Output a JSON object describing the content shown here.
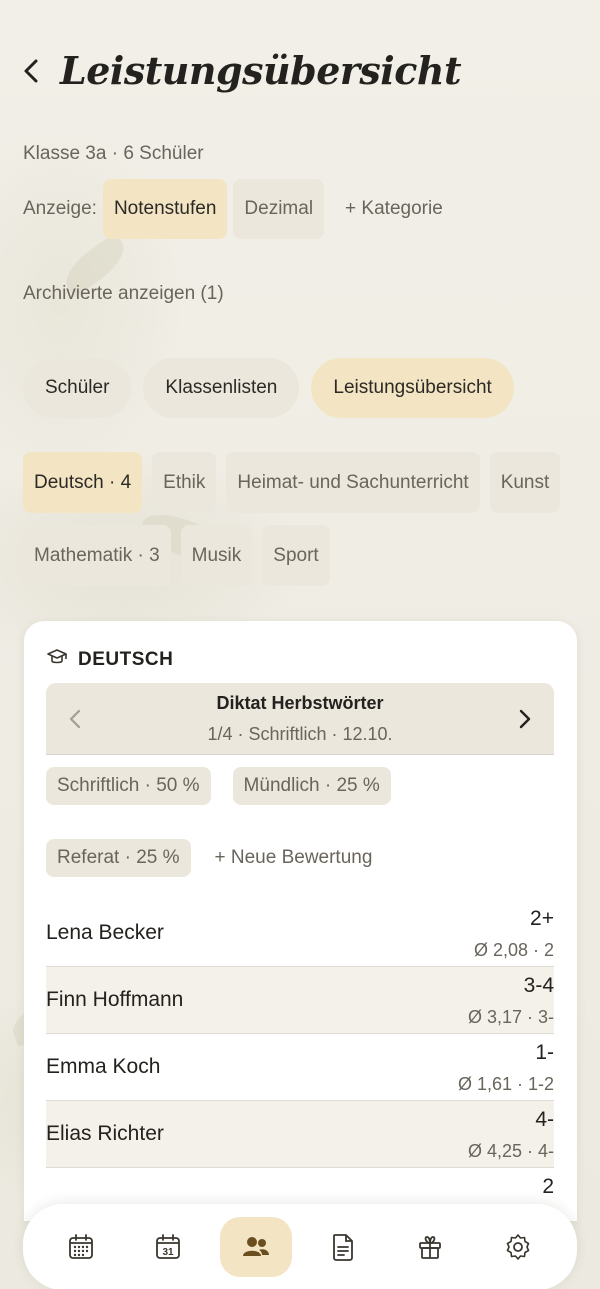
{
  "header": {
    "title": "Leistungsübersicht"
  },
  "meta": {
    "class_info": "Klasse 3a · 6 Schüler"
  },
  "view": {
    "label": "Anzeige:",
    "options": [
      "Notenstufen",
      "Dezimal"
    ],
    "selected": "Notenstufen",
    "add_category": "+ Kategorie"
  },
  "archived": "Archivierte anzeigen (1)",
  "tabs": [
    {
      "label": "Schüler"
    },
    {
      "label": "Klassenlisten"
    },
    {
      "label": "Leistungsübersicht",
      "active": true
    }
  ],
  "subjects": [
    {
      "label": "Deutsch · 4",
      "active": true
    },
    {
      "label": "Ethik"
    },
    {
      "label": "Heimat- und Sachunterricht"
    },
    {
      "label": "Kunst"
    },
    {
      "label": "Mathematik · 3"
    },
    {
      "label": "Musik"
    },
    {
      "label": "Sport"
    }
  ],
  "card": {
    "title": "DEUTSCH",
    "assessment": {
      "title": "Diktat Herbstwörter",
      "subtitle": "1/4 · Schriftlich · 12.10."
    },
    "weights": [
      "Schriftlich · 50 %",
      "Mündlich · 25 %",
      "Referat · 25 %"
    ],
    "new_evaluation": "+ Neue Bewertung",
    "students": [
      {
        "name": "Lena Becker",
        "grade": "2+",
        "avg": "Ø 2,08 · 2"
      },
      {
        "name": "Finn Hoffmann",
        "grade": "3-4",
        "avg": "Ø 3,17 · 3-"
      },
      {
        "name": "Emma Koch",
        "grade": "1-",
        "avg": "Ø 1,61 · 1-2"
      },
      {
        "name": "Elias Richter",
        "grade": "4-",
        "avg": "Ø 4,25 · 4-"
      },
      {
        "name": "",
        "grade": "2",
        "avg": ""
      }
    ]
  },
  "bottom_nav": [
    {
      "icon": "calendar-grid-icon"
    },
    {
      "icon": "calendar-date-icon",
      "date": "31"
    },
    {
      "icon": "users-icon",
      "active": true
    },
    {
      "icon": "document-icon"
    },
    {
      "icon": "gift-icon"
    },
    {
      "icon": "settings-icon"
    }
  ],
  "colors": {
    "accent": "#f3e5c3",
    "chip": "#ebe7dc",
    "text": "#24221e",
    "muted": "#6a655c"
  }
}
